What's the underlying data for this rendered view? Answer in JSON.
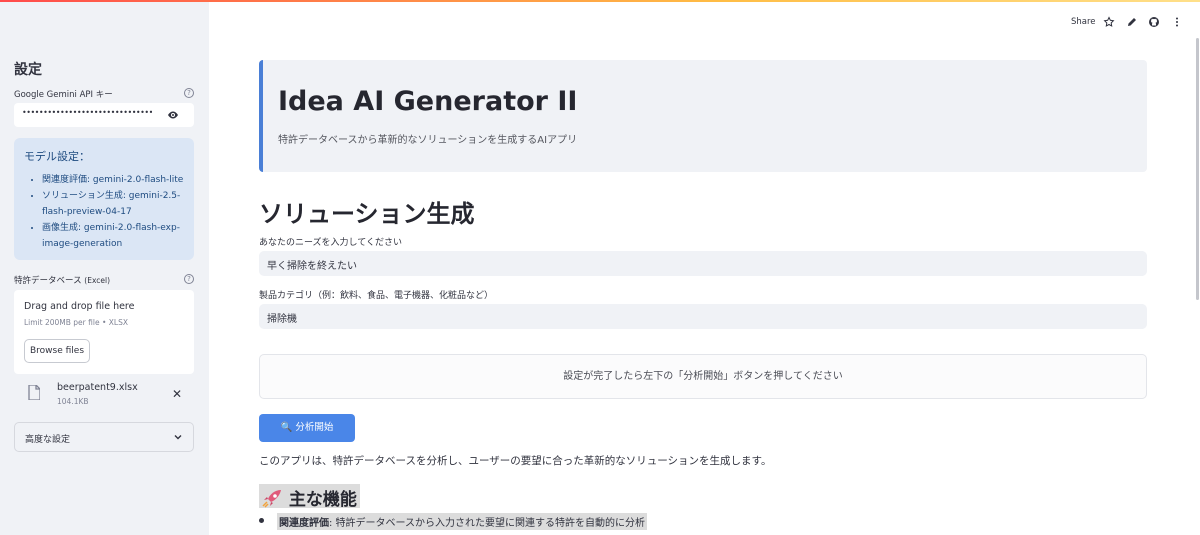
{
  "sidebar": {
    "title": "設定",
    "api_key": {
      "label": "Google Gemini API キー",
      "masked_value": "••••••••••••••••••••••••••••••••••••••••"
    },
    "model_settings": {
      "heading": "モデル設定：",
      "items": [
        {
          "label": "関連度評価:",
          "value": "gemini-2.0-flash-lite"
        },
        {
          "label": "ソリューション生成:",
          "value": "gemini-2.5-flash-preview-04-17"
        },
        {
          "label": "画像生成:",
          "value": "gemini-2.0-flash-exp-image-generation"
        }
      ]
    },
    "patent_db": {
      "label": "特許データベース",
      "label_suffix": "(Excel)",
      "dropzone_text": "Drag and drop file here",
      "limit_text": "Limit 200MB per file • XLSX",
      "browse_label": "Browse files",
      "file_name": "beerpatent9.xlsx",
      "file_size": "104.1KB"
    },
    "advanced_label": "高度な設定"
  },
  "toolbar": {
    "share_label": "Share"
  },
  "hero": {
    "title": "Idea AI Generator II",
    "subtitle": "特許データベースから革新的なソリューションを生成するAIアプリ"
  },
  "main": {
    "section_title": "ソリューション生成",
    "needs_label": "あなたのニーズを入力してください",
    "needs_value": "早く掃除を終えたい",
    "category_label": "製品カテゴリ（例：飲料、食品、電子機器、化粧品など）",
    "category_value": "掃除機",
    "info_text": "設定が完了したら左下の「分析開始」ボタンを押してください",
    "run_button_icon": "🔍",
    "run_button_label": "分析開始",
    "description": "このアプリは、特許データベースを分析し、ユーザーの要望に合った革新的なソリューションを生成します。",
    "features_title": "主な機能",
    "features": [
      {
        "name": "関連度評価",
        "text": ": 特許データベースから入力された要望に関連する特許を自動的に分析"
      }
    ]
  },
  "colors": {
    "sidebar_bg": "#f0f2f6",
    "accent": "#4a86e8",
    "info_box_bg": "#dbe6f5"
  }
}
